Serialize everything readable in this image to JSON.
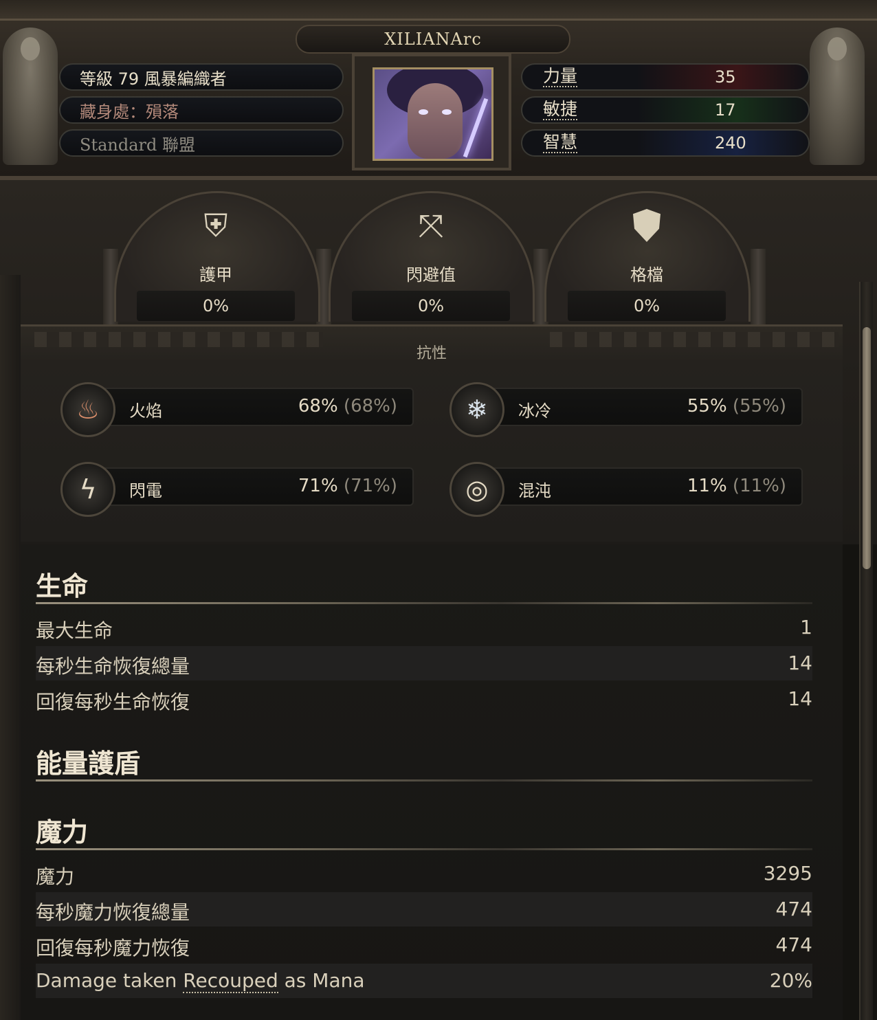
{
  "character": {
    "name": "XILIANArc",
    "level_line": "等級 79 風暴編織者",
    "hideout": "藏身處：殞落",
    "league": "Standard 聯盟"
  },
  "attributes": [
    {
      "label": "力量",
      "value": "35"
    },
    {
      "label": "敏捷",
      "value": "17"
    },
    {
      "label": "智慧",
      "value": "240"
    }
  ],
  "defences": [
    {
      "label": "護甲",
      "value": "0%",
      "icon": "armour-icon"
    },
    {
      "label": "閃避值",
      "value": "0%",
      "icon": "evasion-icon"
    },
    {
      "label": "格檔",
      "value": "0%",
      "icon": "block-shield-icon"
    }
  ],
  "resistances": {
    "title": "抗性",
    "items": [
      {
        "label": "火焰",
        "value": "68%",
        "max": "(68%)",
        "icon": "fire-icon",
        "color": "#b45a3c"
      },
      {
        "label": "冰冷",
        "value": "55%",
        "max": "(55%)",
        "icon": "cold-icon",
        "color": "#7fa8c9"
      },
      {
        "label": "閃電",
        "value": "71%",
        "max": "(71%)",
        "icon": "lightning-icon",
        "color": "#d9c56a"
      },
      {
        "label": "混沌",
        "value": "11%",
        "max": "(11%)",
        "icon": "chaos-icon",
        "color": "#b89ac9"
      }
    ]
  },
  "sections": {
    "life": {
      "title": "生命",
      "rows": [
        {
          "label": "最大生命",
          "value": "1"
        },
        {
          "label": "每秒生命恢復總量",
          "value": "14"
        },
        {
          "label": "回復每秒生命恢復",
          "value": "14"
        }
      ]
    },
    "energy_shield": {
      "title": "能量護盾"
    },
    "mana": {
      "title": "魔力",
      "rows": [
        {
          "label": "魔力",
          "value": "3295"
        },
        {
          "label": "每秒魔力恢復總量",
          "value": "474"
        },
        {
          "label": "回復每秒魔力恢復",
          "value": "474"
        }
      ],
      "recoup": {
        "prefix": "Damage taken ",
        "link": "Recouped",
        "suffix": " as Mana",
        "value": "20%"
      }
    }
  }
}
